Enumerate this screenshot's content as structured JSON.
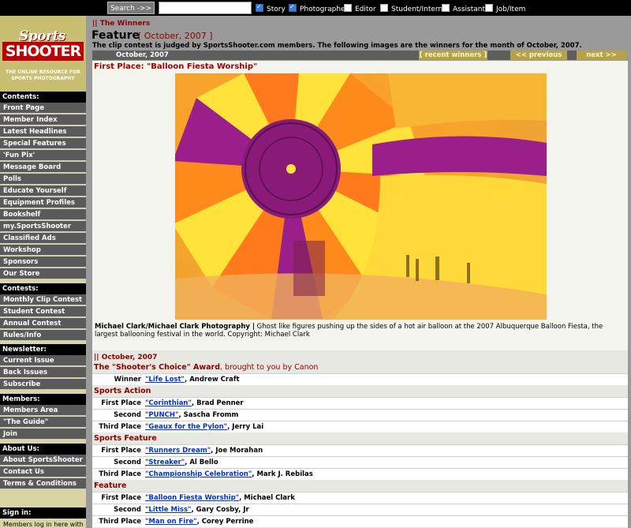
{
  "topbar": {
    "search_button": "Search ->>",
    "search_value": "",
    "filters": [
      {
        "label": "Story",
        "checked": true
      },
      {
        "label": "Photographer",
        "checked": true
      },
      {
        "label": "Editor",
        "checked": false
      },
      {
        "label": "Student/Intern",
        "checked": false
      },
      {
        "label": "Assistant",
        "checked": false
      },
      {
        "label": "Job/Item",
        "checked": false
      }
    ]
  },
  "logo": {
    "line1": "Sports",
    "line2": "SHOOTER",
    "tagline1": "THE ONLINE RESOURCE FOR",
    "tagline2": "SPORTS PHOTOGRAPHY"
  },
  "sidebar": {
    "contents": {
      "title": "Contents:",
      "items": [
        "Front Page",
        "Member Index",
        "Latest Headlines",
        "Special Features",
        "'Fun Pix'",
        "Message Board",
        "Polls",
        "Educate Yourself",
        "Equipment Profiles",
        "Bookshelf",
        "my.SportsShooter",
        "Classified Ads",
        "Workshop",
        "Sponsors",
        "Our Store"
      ]
    },
    "contests": {
      "title": "Contests:",
      "items": [
        "Monthly Clip Contest",
        "Student Contest",
        "Annual Contest",
        "Rules/Info"
      ]
    },
    "newsletter": {
      "title": "Newsletter:",
      "items": [
        "Current Issue",
        "Back Issues",
        "Subscribe"
      ]
    },
    "members": {
      "title": "Members:",
      "items": [
        "Members Area",
        "\"The Guide\"",
        "Join"
      ]
    },
    "about": {
      "title": "About Us:",
      "items": [
        "About SportsShooter",
        "Contact Us",
        "Terms & Conditions"
      ]
    },
    "signin": {
      "title": "Sign in:",
      "text": "Members log in here with"
    }
  },
  "main": {
    "crumb": "|| The Winners",
    "title": "Feature",
    "date": "[ October, 2007 ]",
    "judged": "The clip contest is judged by SportsShooter.com members. The following images are the winners for the month of October, 2007.",
    "month_label": "October, 2007",
    "recent_winners": "[ recent winners ]",
    "previous": "<< previous",
    "next": "next >>",
    "first_place_heading": "First Place: \"Balloon Fiesta Worship\"",
    "caption_credit": "Michael Clark/Michael Clark Photography |",
    "caption_text": " Ghost like figures pushing up the sides of a hot air balloon at the 2007 Albuquerque Balloon Fiesta, the largest ballooning festival in the world. Copyright: Michael Clark"
  },
  "results": {
    "crumb": "|| October, 2007",
    "shooters_choice": {
      "heading_bold": "The \"Shooter's Choice\" Award",
      "heading_rest": ", brought to you by Canon",
      "winner_label": "Winner",
      "title": "\"Life Lost\"",
      "name": ", Andrew Craft"
    },
    "categories": [
      {
        "name": "Sports Action",
        "rows": [
          {
            "place": "First Place",
            "title": "\"Corinthian\"",
            "name": ", Brad Penner"
          },
          {
            "place": "Second Place",
            "title": "\"PUNCH\"",
            "name": ", Sascha Fromm"
          },
          {
            "place": "Third Place",
            "title": "\"Geaux for the Pylon\"",
            "name": ", Jerry Lai"
          }
        ]
      },
      {
        "name": "Sports Feature",
        "rows": [
          {
            "place": "First Place",
            "title": "\"Runners Dream\"",
            "name": ", Joe Morahan"
          },
          {
            "place": "Second Place",
            "title": "\"Streaker\"",
            "name": ", Al Bello"
          },
          {
            "place": "Third Place",
            "title": "\"Championship Celebration\"",
            "name": ", Mark J. Rebilas"
          }
        ]
      },
      {
        "name": "Feature",
        "rows": [
          {
            "place": "First Place",
            "title": "\"Balloon Fiesta Worship\"",
            "name": ", Michael Clark"
          },
          {
            "place": "Second Place",
            "title": "\"Little Miss\"",
            "name": ", Gary Cosby, Jr"
          },
          {
            "place": "Third Place",
            "title": "\"Man on Fire\"",
            "name": ", Corey Perrine"
          }
        ]
      }
    ]
  }
}
